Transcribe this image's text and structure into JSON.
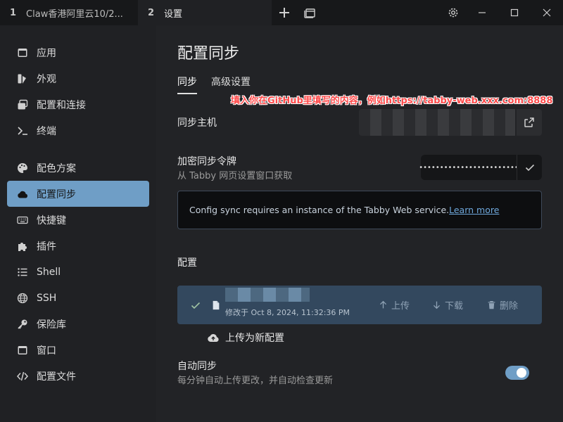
{
  "tabs": [
    {
      "num": "1",
      "label": "Claw香港阿里云10/2..."
    },
    {
      "num": "2",
      "label": "设置"
    }
  ],
  "sidebar": {
    "items": [
      {
        "label": "应用",
        "icon": "window-icon"
      },
      {
        "label": "外观",
        "icon": "appearance-icon"
      },
      {
        "label": "配置和连接",
        "icon": "profiles-icon"
      },
      {
        "label": "终端",
        "icon": "terminal-icon"
      },
      {
        "label": "配色方案",
        "icon": "palette-icon"
      },
      {
        "label": "配置同步",
        "icon": "cloud-icon"
      },
      {
        "label": "快捷键",
        "icon": "keyboard-icon"
      },
      {
        "label": "插件",
        "icon": "puzzle-icon"
      },
      {
        "label": "Shell",
        "icon": "list-icon"
      },
      {
        "label": "SSH",
        "icon": "globe-icon"
      },
      {
        "label": "保险库",
        "icon": "key-icon"
      },
      {
        "label": "窗口",
        "icon": "window-icon"
      },
      {
        "label": "配置文件",
        "icon": "code-icon"
      }
    ]
  },
  "main": {
    "title": "配置同步",
    "subtabs": [
      "同步",
      "高级设置"
    ],
    "annotation": "填入你在GitHub里填写的内容，例如https://tabby-web.xxx.com:8888",
    "host_label": "同步主机",
    "token_label": "加密同步令牌",
    "token_hint": "从 Tabby 网页设置窗口获取",
    "token_value": "••••••••••••••••••••••••",
    "info_text": "Config sync requires an instance of the Tabby Web service.",
    "info_link": "Learn more",
    "configs_label": "配置",
    "config_item": {
      "date": "修改于 Oct 8, 2024, 11:32:36 PM",
      "upload": "上传",
      "download": "下载",
      "delete": "删除"
    },
    "upload_new": "上传为新配置",
    "auto_sync_label": "自动同步",
    "auto_sync_hint": "每分钟自动上传更改，并自动检查更新",
    "auto_sync_on": true
  },
  "colors": {
    "accent": "#6f9ec6",
    "annotation": "#ff4a4a"
  }
}
